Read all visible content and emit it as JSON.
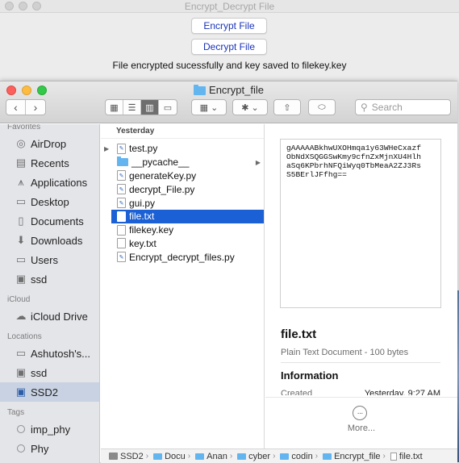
{
  "tk_app": {
    "title": "Encrypt_Decrypt File",
    "encrypt_label": "Encrypt File",
    "decrypt_label": "Decrypt File",
    "status": "File encrypted sucessfully and key saved to filekey.key"
  },
  "finder": {
    "title": "Encrypt_file",
    "search_placeholder": "Search",
    "sidebar": {
      "favorites_header": "Favorites",
      "favorites": [
        {
          "label": "AirDrop",
          "icon": "airdrop-icon"
        },
        {
          "label": "Recents",
          "icon": "recents-icon"
        },
        {
          "label": "Applications",
          "icon": "applications-icon"
        },
        {
          "label": "Desktop",
          "icon": "desktop-icon"
        },
        {
          "label": "Documents",
          "icon": "documents-icon"
        },
        {
          "label": "Downloads",
          "icon": "downloads-icon"
        },
        {
          "label": "Users",
          "icon": "folder-icon"
        },
        {
          "label": "ssd",
          "icon": "disk-icon"
        }
      ],
      "icloud_header": "iCloud",
      "icloud": [
        {
          "label": "iCloud Drive",
          "icon": "cloud-icon"
        }
      ],
      "locations_header": "Locations",
      "locations": [
        {
          "label": "Ashutosh's...",
          "icon": "computer-icon"
        },
        {
          "label": "ssd",
          "icon": "disk-icon"
        },
        {
          "label": "SSD2",
          "icon": "disk-icon",
          "selected": true
        }
      ],
      "tags_header": "Tags",
      "tags": [
        {
          "label": "imp_phy"
        },
        {
          "label": "Phy"
        }
      ]
    },
    "list": {
      "header": "Yesterday",
      "items": [
        {
          "name": "test.py",
          "kind": "py",
          "disclosure": true
        },
        {
          "name": "__pycache__",
          "kind": "folder",
          "chevron": true
        },
        {
          "name": "generateKey.py",
          "kind": "py"
        },
        {
          "name": "decrypt_File.py",
          "kind": "py"
        },
        {
          "name": "gui.py",
          "kind": "py"
        },
        {
          "name": "file.txt",
          "kind": "txt",
          "selected": true
        },
        {
          "name": "filekey.key",
          "kind": "key"
        },
        {
          "name": "key.txt",
          "kind": "txt"
        },
        {
          "name": "Encrypt_decrypt_files.py",
          "kind": "py"
        }
      ]
    },
    "preview": {
      "content": "gAAAAABkhwUXOHmqa1y63WHeCxazf\nObNdXSQGGSwKmy9cfnZxMjnXU4Hlh\naSq6KPbrhNFQiWyq0TbMeaA2ZJ3Rs\nS5BErlJFfhg==",
      "file_name": "file.txt",
      "file_kind": "Plain Text Document - 100 bytes",
      "info_header": "Information",
      "created_label": "Created",
      "created_value": "Yesterday, 9:27 AM",
      "more_label": "More..."
    },
    "path": [
      "SSD2",
      "Docu",
      "Anan",
      "cyber",
      "codin",
      "Encrypt_file",
      "file.txt"
    ]
  },
  "colors": {
    "selection": "#1b60d4",
    "button_text": "#1a33b8",
    "folder": "#63b5f0"
  }
}
